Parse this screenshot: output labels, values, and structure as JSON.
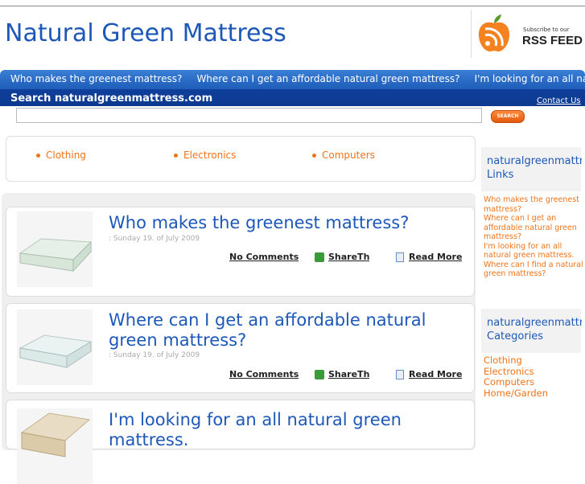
{
  "header": {
    "site_title": "Natural Green Mattress",
    "rss_subscribe": "Subscribe to our",
    "rss_feed": "RSS FEED"
  },
  "nav": {
    "items": [
      "Who makes the greenest mattress?",
      "Where can I get an affordable natural green mattress?",
      "I'm looking for an all natural green mattress."
    ]
  },
  "search": {
    "label": "Search naturalgreenmattress.com",
    "contact": "Contact Us",
    "button": "SEARCH",
    "value": ""
  },
  "categories_bar": {
    "items": [
      "Clothing",
      "Electronics",
      "Computers"
    ]
  },
  "posts": [
    {
      "title": "Who makes the greenest mattress?",
      "date": ": Sunday 19. of July 2009",
      "comments": "No Comments",
      "share": "ShareThis",
      "read_more": "Read More"
    },
    {
      "title": "Where can I get an affordable natural green mattress?",
      "date": ": Sunday 19. of July 2009",
      "comments": "No Comments",
      "share": "ShareThis",
      "read_more": "Read More"
    },
    {
      "title": "I'm looking for an all natural green mattress."
    }
  ],
  "sidebar": {
    "links_title": "naturalgreenmattress.com Links",
    "links_title_line1": "naturalgreenmattress.com",
    "links_title_line2": "Links",
    "links": [
      "Who makes the greenest mattress?",
      "Where can I get an affordable natural green mattress?",
      "I'm looking for an all natural green mattress.",
      "Where can I find a natural green mattress?"
    ],
    "categories_title_line1": "naturalgreenmattress.com",
    "categories_title_line2": "Categories",
    "categories": [
      "Clothing",
      "Electronics",
      "Computers",
      "Home/Garden"
    ]
  },
  "colors": {
    "title_blue": "#1d58b8",
    "accent_orange": "#f07318",
    "nav_blue": "#1e5cb8"
  }
}
